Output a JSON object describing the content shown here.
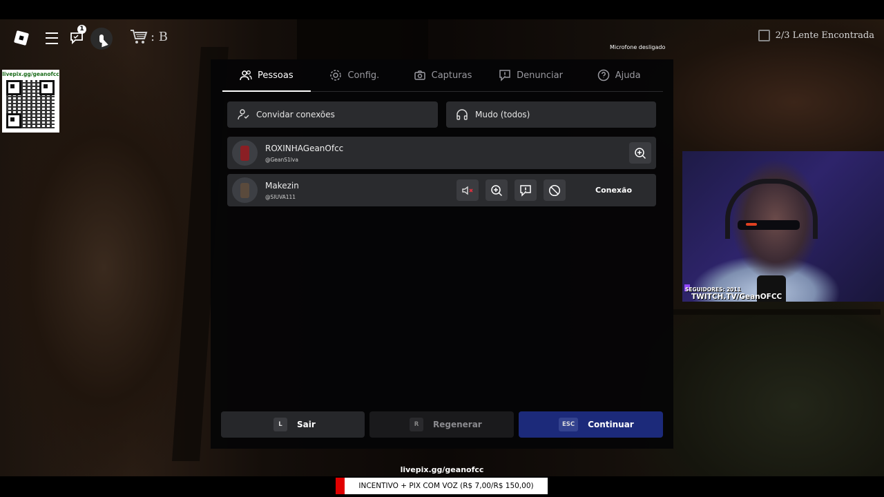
{
  "hud": {
    "chat_badge_count": "1",
    "cart_label": ": B",
    "mic_status": "Microfone desligado",
    "lens_counter": "2/3 Lente Encontrada"
  },
  "qr": {
    "label": "livepix.gg/geanofcc"
  },
  "menu": {
    "tabs": [
      {
        "label": "Pessoas",
        "icon": "people-icon",
        "active": true
      },
      {
        "label": "Config.",
        "icon": "gear-icon",
        "active": false
      },
      {
        "label": "Capturas",
        "icon": "camera-icon",
        "active": false
      },
      {
        "label": "Denunciar",
        "icon": "report-icon",
        "active": false
      },
      {
        "label": "Ajuda",
        "icon": "help-icon",
        "active": false
      }
    ],
    "invite_label": "Convidar conexões",
    "mute_all_label": "Mudo (todos)",
    "players": [
      {
        "name": "ROXINHAGeanOfcc",
        "username": "@GeanS1lva"
      },
      {
        "name": "Makezin",
        "username": "@SIUVA111",
        "connection_label": "Conexão"
      }
    ],
    "footer": {
      "leave": {
        "key": "L",
        "label": "Sair"
      },
      "reset": {
        "key": "R",
        "label": "Regenerar"
      },
      "resume": {
        "key": "ESC",
        "label": "Continuar"
      }
    }
  },
  "webcam": {
    "followers": "SEGUIDORES: 2011",
    "twitch": "TWITCH.TV/GeanOFCC"
  },
  "overlay": {
    "livepix": "livepix.gg/geanofcc",
    "incentivo": "INCENTIVO + PIX COM VOZ (R$ 7,00/R$ 150,00)"
  },
  "colors": {
    "resume_button": "#1c2a7a",
    "alert_red": "#e00000",
    "twitch_purple": "#9146ff"
  }
}
